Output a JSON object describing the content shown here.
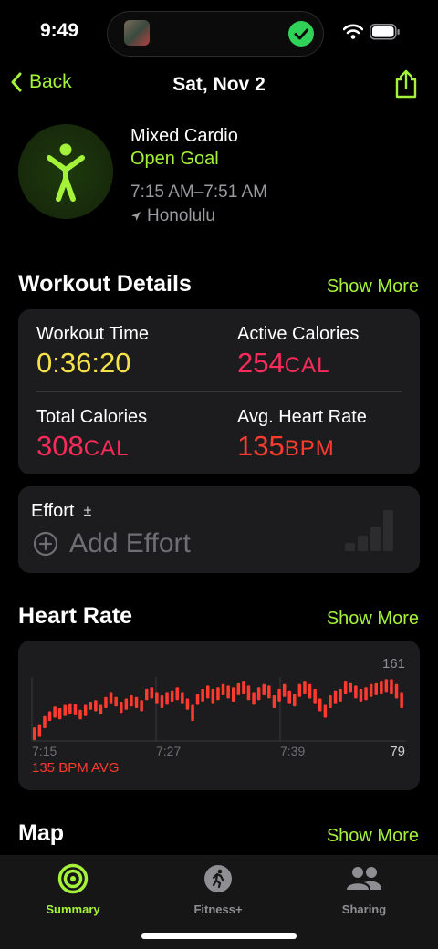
{
  "status_bar": {
    "time": "9:49"
  },
  "nav": {
    "back_label": "Back",
    "title": "Sat, Nov 2"
  },
  "workout": {
    "name": "Mixed Cardio",
    "goal": "Open Goal",
    "time_range": "7:15 AM–7:51 AM",
    "location": "Honolulu"
  },
  "details": {
    "title": "Workout Details",
    "show_more": "Show More",
    "workout_time": {
      "label": "Workout Time",
      "value": "0:36:20"
    },
    "active_calories": {
      "label": "Active Calories",
      "value": "254",
      "unit": "CAL"
    },
    "total_calories": {
      "label": "Total Calories",
      "value": "308",
      "unit": "CAL"
    },
    "avg_heart_rate": {
      "label": "Avg. Heart Rate",
      "value": "135",
      "unit": "BPM"
    }
  },
  "effort": {
    "label": "Effort",
    "add_label": "Add Effort"
  },
  "heart_rate": {
    "title": "Heart Rate",
    "show_more": "Show More",
    "avg_text": "135 BPM AVG"
  },
  "chart_data": {
    "type": "bar",
    "x_tick_labels": [
      "7:15",
      "7:27",
      "7:39"
    ],
    "max_label": "161",
    "min_label": "79",
    "ylim": [
      79,
      161
    ],
    "series": [
      {
        "color": "#ff3b30",
        "values": [
          [
            80,
            96
          ],
          [
            84,
            100
          ],
          [
            95,
            110
          ],
          [
            104,
            116
          ],
          [
            108,
            122
          ],
          [
            106,
            120
          ],
          [
            110,
            124
          ],
          [
            112,
            126
          ],
          [
            111,
            125
          ],
          [
            106,
            118
          ],
          [
            110,
            124
          ],
          [
            118,
            128
          ],
          [
            116,
            130
          ],
          [
            112,
            124
          ],
          [
            120,
            134
          ],
          [
            126,
            140
          ],
          [
            122,
            134
          ],
          [
            114,
            128
          ],
          [
            118,
            132
          ],
          [
            122,
            136
          ],
          [
            120,
            134
          ],
          [
            116,
            130
          ],
          [
            130,
            144
          ],
          [
            132,
            146
          ],
          [
            126,
            140
          ],
          [
            120,
            136
          ],
          [
            124,
            140
          ],
          [
            128,
            142
          ],
          [
            130,
            146
          ],
          [
            126,
            140
          ],
          [
            118,
            132
          ],
          [
            104,
            124
          ],
          [
            124,
            138
          ],
          [
            128,
            144
          ],
          [
            132,
            148
          ],
          [
            126,
            144
          ],
          [
            130,
            146
          ],
          [
            136,
            150
          ],
          [
            132,
            148
          ],
          [
            128,
            146
          ],
          [
            136,
            152
          ],
          [
            138,
            154
          ],
          [
            130,
            148
          ],
          [
            124,
            140
          ],
          [
            130,
            146
          ],
          [
            136,
            150
          ],
          [
            132,
            148
          ],
          [
            120,
            136
          ],
          [
            128,
            144
          ],
          [
            134,
            150
          ],
          [
            126,
            142
          ],
          [
            122,
            138
          ],
          [
            134,
            150
          ],
          [
            138,
            154
          ],
          [
            132,
            150
          ],
          [
            126,
            144
          ],
          [
            116,
            132
          ],
          [
            108,
            124
          ],
          [
            120,
            136
          ],
          [
            126,
            142
          ],
          [
            128,
            144
          ],
          [
            138,
            154
          ],
          [
            140,
            152
          ],
          [
            132,
            148
          ],
          [
            128,
            144
          ],
          [
            130,
            146
          ],
          [
            134,
            150
          ],
          [
            136,
            152
          ],
          [
            138,
            154
          ],
          [
            140,
            156
          ],
          [
            138,
            156
          ],
          [
            132,
            150
          ],
          [
            120,
            140
          ]
        ]
      }
    ]
  },
  "map": {
    "title": "Map",
    "show_more": "Show More"
  },
  "tabs": {
    "summary": "Summary",
    "fitness_plus": "Fitness+",
    "sharing": "Sharing"
  },
  "colors": {
    "accent": "#a4f23a",
    "yellow": "#f5e14b",
    "pink": "#fa2a5a",
    "red": "#ff3b30",
    "card": "#1c1c1e"
  }
}
